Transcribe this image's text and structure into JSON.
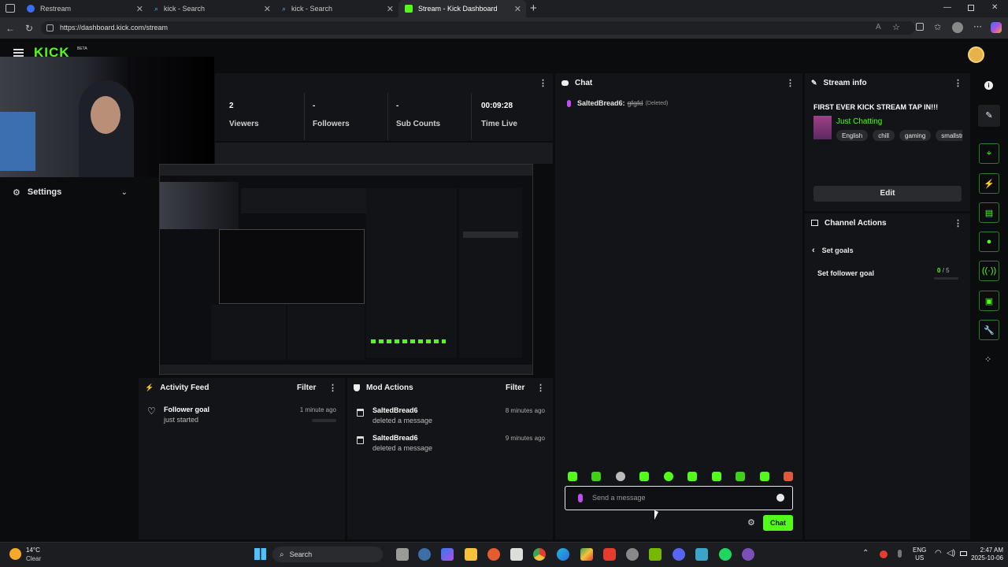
{
  "browser": {
    "tabs": [
      {
        "label": "Restream",
        "color": "#3a6df0"
      },
      {
        "label": "kick - Search",
        "color": "#3c8bd9"
      },
      {
        "label": "kick - Search",
        "color": "#3c8bd9"
      },
      {
        "label": "Stream - Kick Dashboard",
        "color": "#53fc18"
      }
    ],
    "url": "https://dashboard.kick.com/stream",
    "new_tab": "+"
  },
  "brand": {
    "logo": "KICK",
    "beta": "BETA",
    "accent": "#53fc18"
  },
  "sidebar": {
    "settings_label": "Settings"
  },
  "stats": [
    {
      "value": "2",
      "label": "Viewers"
    },
    {
      "value": "-",
      "label": "Followers"
    },
    {
      "value": "-",
      "label": "Sub Counts"
    },
    {
      "value": "00:09:28",
      "label": "Time Live"
    }
  ],
  "activity_feed": {
    "title": "Activity Feed",
    "filter": "Filter",
    "items": [
      {
        "title": "Follower goal",
        "sub": "just started",
        "time": "1 minute ago"
      }
    ]
  },
  "mod_actions": {
    "title": "Mod Actions",
    "filter": "Filter",
    "items": [
      {
        "user": "SaltedBread6",
        "action": "deleted a message",
        "time": "8 minutes ago"
      },
      {
        "user": "SaltedBread6",
        "action": "deleted a message",
        "time": "9 minutes ago"
      }
    ]
  },
  "chat": {
    "title": "Chat",
    "messages": [
      {
        "user": "SaltedBread6:",
        "text": "gfgfd",
        "note": "(Deleted)"
      }
    ],
    "placeholder": "Send a message",
    "send": "Chat"
  },
  "stream_info": {
    "title": "Stream info",
    "stream_title": "FIRST EVER KICK STREAM TAP IN!!!",
    "category": "Just Chatting",
    "tags": [
      "English",
      "chill",
      "gaming",
      "smallstre"
    ],
    "edit": "Edit"
  },
  "channel_actions": {
    "title": "Channel Actions",
    "back_label": "Set goals",
    "goal_label": "Set follower goal",
    "goal_current": "0",
    "goal_total": "/ 5"
  },
  "taskbar": {
    "weather_temp": "14°C",
    "weather_desc": "Clear",
    "search": "Search",
    "lang1": "ENG",
    "lang2": "US",
    "time": "2:47 AM",
    "date": "2025-10-06"
  }
}
